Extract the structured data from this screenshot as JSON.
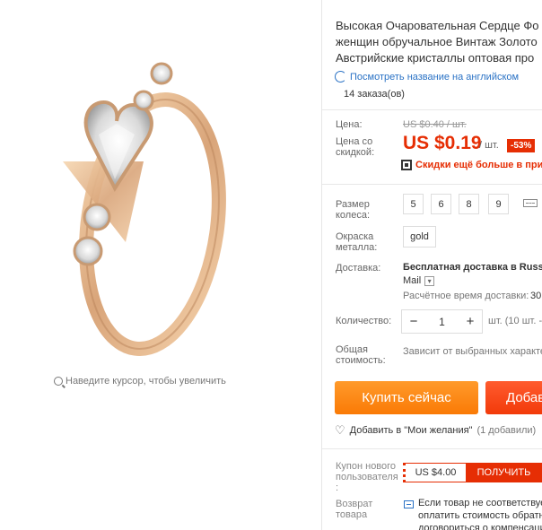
{
  "gallery": {
    "zoom_hint": "Наведите курсор, чтобы увеличить"
  },
  "product": {
    "title_lines": [
      "Высокая Очаровательная Сердце Фо",
      "женщин обручальное Винтаж Золото",
      "Австрийские кристаллы оптовая про"
    ],
    "translate_link": "Посмотреть название на английском",
    "orders": "14 заказа(ов)"
  },
  "price": {
    "label": "Цена:",
    "old_value": "US $0.40 / шт.",
    "sale_label_lines": [
      "Цена со",
      "скидкой:"
    ],
    "sale_value": "US $0.19",
    "per_unit": "/ шт.",
    "discount": "-53%",
    "promo": "Скидки ещё больше в прил"
  },
  "options": {
    "size_label_lines": [
      "Размер",
      "колеса:"
    ],
    "sizes": [
      "5",
      "6",
      "8",
      "9"
    ],
    "color_label_lines": [
      "Окраска",
      "металла:"
    ],
    "color_value": "gold"
  },
  "shipping": {
    "label": "Доставка:",
    "main": "Бесплатная доставка в Russia",
    "carrier": "Mail",
    "time_label": "Расчётное время доставки:",
    "time_value": "30"
  },
  "quantity": {
    "label": "Количество:",
    "minus": "−",
    "value": "1",
    "plus": "+",
    "unit": "шт. (10 шт. -"
  },
  "total": {
    "label_lines": [
      "Общая",
      "стоимость:"
    ],
    "value": "Зависит от выбранных характе"
  },
  "actions": {
    "buy_now": "Купить сейчас",
    "add_to_cart": "Добав",
    "wishlist": "Добавить в \"Мои желания\"",
    "wishlist_count": "(1 добавили)"
  },
  "coupon": {
    "label_lines": [
      "Купон нового",
      "пользователя",
      ":"
    ],
    "value": "US $4.00",
    "button": "ПОЛУЧИТЬ"
  },
  "returns": {
    "label_lines": [
      "Возврат",
      "товара"
    ],
    "text_lines": [
      "Если товар не соответствуе",
      "оплатить стоимость обратн",
      "договориться о компенсаци"
    ]
  },
  "colors": {
    "accent_red": "#e62e04",
    "buy_orange": "#fa7a06",
    "link_blue": "#2a72c5"
  }
}
